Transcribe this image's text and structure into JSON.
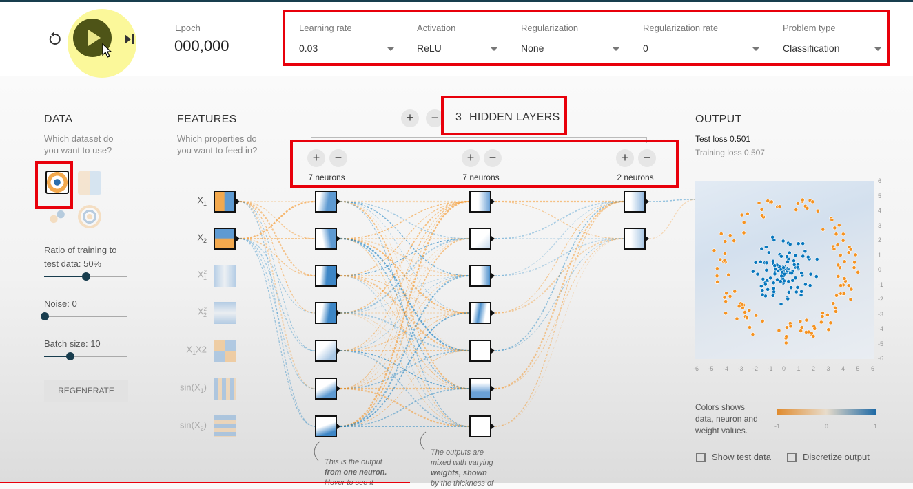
{
  "controls": {
    "epoch_label": "Epoch",
    "epoch_value": "000,000",
    "learning_rate": {
      "label": "Learning rate",
      "value": "0.03"
    },
    "activation": {
      "label": "Activation",
      "value": "ReLU"
    },
    "regularization": {
      "label": "Regularization",
      "value": "None"
    },
    "regularization_rate": {
      "label": "Regularization rate",
      "value": "0"
    },
    "problem_type": {
      "label": "Problem type",
      "value": "Classification"
    }
  },
  "data": {
    "title": "DATA",
    "subtitle_1": "Which dataset do",
    "subtitle_2": "you want to use?",
    "ratio_label_1": "Ratio of training to",
    "ratio_label_2": "test data:  50%",
    "ratio_value": 0.5,
    "noise_label": "Noise:  0",
    "noise_value": 0,
    "batch_label": "Batch size:  10",
    "batch_value": 10,
    "regenerate": "REGENERATE"
  },
  "features": {
    "title": "FEATURES",
    "subtitle_1": "Which properties do",
    "subtitle_2": "you want to feed in?",
    "items": [
      {
        "base": "X",
        "sub": "1",
        "sup": "",
        "rest": "",
        "active": true
      },
      {
        "base": "X",
        "sub": "2",
        "sup": "",
        "rest": "",
        "active": true
      },
      {
        "base": "X",
        "sub": "1",
        "sup": "2",
        "rest": "",
        "active": false
      },
      {
        "base": "X",
        "sub": "2",
        "sup": "2",
        "rest": "",
        "active": false
      },
      {
        "base": "X",
        "sub": "1",
        "sup": "",
        "rest": "X2",
        "active": false
      },
      {
        "base": "sin(X",
        "sub": "1",
        "sup": "",
        "rest": ")",
        "active": false
      },
      {
        "base": "sin(X",
        "sub": "2",
        "sup": "",
        "rest": ")",
        "active": false
      }
    ]
  },
  "network": {
    "hidden_count": "3",
    "hidden_label": "HIDDEN LAYERS",
    "plus": "+",
    "minus": "−",
    "layers": [
      {
        "label": "7 neurons",
        "neurons": 7
      },
      {
        "label": "7 neurons",
        "neurons": 7
      },
      {
        "label": "2 neurons",
        "neurons": 2
      }
    ],
    "note_1": [
      "This is the output",
      "from one neuron.",
      "Hover to see it"
    ],
    "note_2": [
      "The outputs are",
      "mixed with varying",
      "weights, shown",
      "by the thickness of"
    ]
  },
  "output": {
    "title": "OUTPUT",
    "test_loss_label": "Test loss",
    "test_loss_value": "0.501",
    "training_loss_label": "Training loss",
    "training_loss_value": "0.507",
    "x_ticks": [
      "-6",
      "-5",
      "-4",
      "-3",
      "-2",
      "-1",
      "0",
      "1",
      "2",
      "3",
      "4",
      "5",
      "6"
    ],
    "y_ticks": [
      "6",
      "5",
      "4",
      "3",
      "2",
      "1",
      "0",
      "-1",
      "-2",
      "-3",
      "-4",
      "-5",
      "-6"
    ],
    "legend_text": [
      "Colors shows",
      "data, neuron and",
      "weight values."
    ],
    "legend_ticks": [
      "-1",
      "0",
      "1"
    ],
    "show_test_data": "Show test data",
    "discretize_output": "Discretize output"
  },
  "colors": {
    "orange": "#f59322",
    "blue": "#0877bd",
    "red_box": "#e8000b",
    "dark": "#183d4e"
  }
}
